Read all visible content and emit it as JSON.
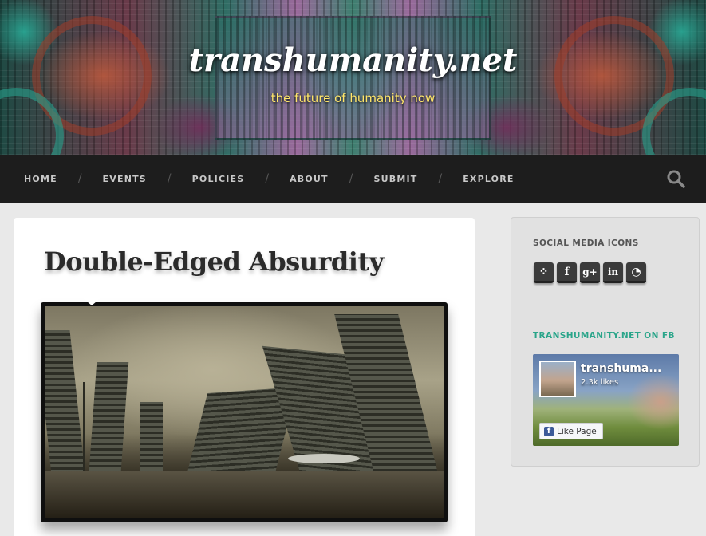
{
  "site": {
    "title": "transhumanity.net",
    "tagline": "the future of humanity now"
  },
  "nav": {
    "items": [
      {
        "label": "HOME"
      },
      {
        "label": "EVENTS"
      },
      {
        "label": "POLICIES"
      },
      {
        "label": "ABOUT"
      },
      {
        "label": "SUBMIT"
      },
      {
        "label": "EXPLORE"
      }
    ],
    "separator": "/",
    "search_icon": "search-icon"
  },
  "post": {
    "title": "Double-Edged Absurdity",
    "image_subject": "post-apocalyptic-ruined-city"
  },
  "sidebar": {
    "social_widget_title": "SOCIAL MEDIA ICONS",
    "social_icons": [
      {
        "icon": "twitter-icon",
        "glyph": "⁘"
      },
      {
        "icon": "facebook-icon",
        "glyph": "f"
      },
      {
        "icon": "google-plus-icon",
        "glyph": "g+"
      },
      {
        "icon": "linkedin-icon",
        "glyph": "in"
      },
      {
        "icon": "rss-icon",
        "glyph": "◔"
      }
    ],
    "fb_widget_title": "TRANSHUMANITY.NET ON FB",
    "fb_widget_title_color": "#2aa58a",
    "fb": {
      "page_name": "transhuma...",
      "likes": "2.3k likes",
      "like_button": "Like Page"
    }
  },
  "colors": {
    "nav_bg": "#1d1d1d",
    "tagline": "#ffe66a",
    "accent_green": "#2aa58a"
  }
}
